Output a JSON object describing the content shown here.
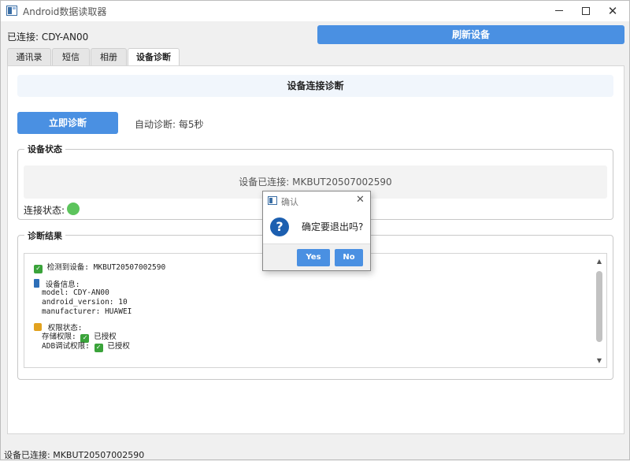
{
  "window": {
    "title": "Android数据读取器"
  },
  "header": {
    "connection_label": "已连接: CDY-AN00",
    "refresh_button": "刷新设备"
  },
  "tabs": [
    {
      "label": "通讯录"
    },
    {
      "label": "短信"
    },
    {
      "label": "相册"
    },
    {
      "label": "设备诊断",
      "active": true
    }
  ],
  "diagnostics": {
    "header": "设备连接诊断",
    "run_button": "立即诊断",
    "auto_label": "自动诊断: 每5秒",
    "device_status": {
      "group_title": "设备状态",
      "status_text": "设备已连接: MKBUT20507002590",
      "connection_state_label": "连接状态:",
      "indicator_color": "#5cc45c"
    },
    "results": {
      "group_title": "诊断结果",
      "detected": "检测到设备: MKBUT20507002590",
      "device_info_title": "设备信息:",
      "model": "model: CDY-AN00",
      "android_version": "android_version: 10",
      "manufacturer": "manufacturer: HUAWEI",
      "permissions_title": "权限状态:",
      "storage_label": "存储权限:",
      "storage_value": "已授权",
      "adb_label": "ADB调试权限:",
      "adb_value": "已授权"
    }
  },
  "statusbar": {
    "text": "设备已连接: MKBUT20507002590"
  },
  "dialog": {
    "title": "确认",
    "message": "确定要退出吗?",
    "yes": "Yes",
    "no": "No"
  },
  "colors": {
    "accent": "#4a90e2",
    "success": "#3aa33a"
  }
}
